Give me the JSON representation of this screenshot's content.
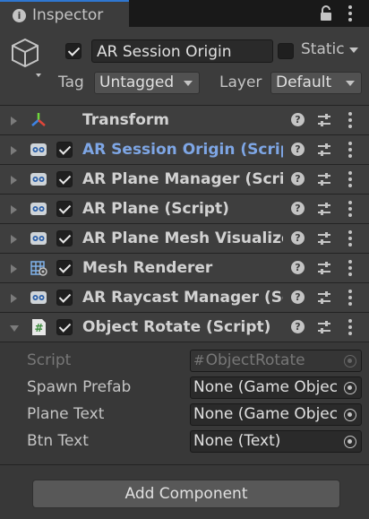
{
  "tab": {
    "title": "Inspector"
  },
  "object": {
    "name": "AR Session Origin",
    "active": true,
    "static_label": "Static",
    "static": false,
    "tag_label": "Tag",
    "tag_value": "Untagged",
    "layer_label": "Layer",
    "layer_value": "Default"
  },
  "components": [
    {
      "name": "Transform",
      "icon": "transform-icon",
      "has_checkbox": false,
      "enabled": true,
      "selected": false,
      "expanded": false
    },
    {
      "name": "AR Session Origin (Script)",
      "icon": "script-ar-icon",
      "has_checkbox": true,
      "enabled": true,
      "selected": true,
      "expanded": false
    },
    {
      "name": "AR Plane Manager (Script)",
      "icon": "script-ar-icon",
      "has_checkbox": true,
      "enabled": true,
      "selected": false,
      "expanded": false
    },
    {
      "name": "AR Plane (Script)",
      "icon": "script-ar-icon",
      "has_checkbox": true,
      "enabled": true,
      "selected": false,
      "expanded": false
    },
    {
      "name": "AR Plane Mesh Visualizer (Script)",
      "icon": "script-ar-icon",
      "has_checkbox": true,
      "enabled": true,
      "selected": false,
      "expanded": false
    },
    {
      "name": "Mesh Renderer",
      "icon": "mesh-renderer-icon",
      "has_checkbox": true,
      "enabled": true,
      "selected": false,
      "expanded": false
    },
    {
      "name": "AR Raycast Manager (Script)",
      "icon": "script-ar-icon",
      "has_checkbox": true,
      "enabled": true,
      "selected": false,
      "expanded": false
    },
    {
      "name": "Object Rotate (Script)",
      "icon": "csharp-script-icon",
      "has_checkbox": true,
      "enabled": true,
      "selected": false,
      "expanded": true
    }
  ],
  "object_rotate": {
    "fields": [
      {
        "label": "Script",
        "value": "ObjectRotate",
        "disabled": true
      },
      {
        "label": "Spawn Prefab",
        "value": "None (Game Object)",
        "disabled": false
      },
      {
        "label": "Plane Text",
        "value": "None (Game Object)",
        "disabled": false
      },
      {
        "label": "Btn Text",
        "value": "None (Text)",
        "disabled": false
      }
    ]
  },
  "add_component": "Add Component",
  "colors": {
    "accent": "#2f77d1",
    "selected_text": "#7ea6e5",
    "panel": "#383838",
    "header": "#3e3e3e"
  }
}
